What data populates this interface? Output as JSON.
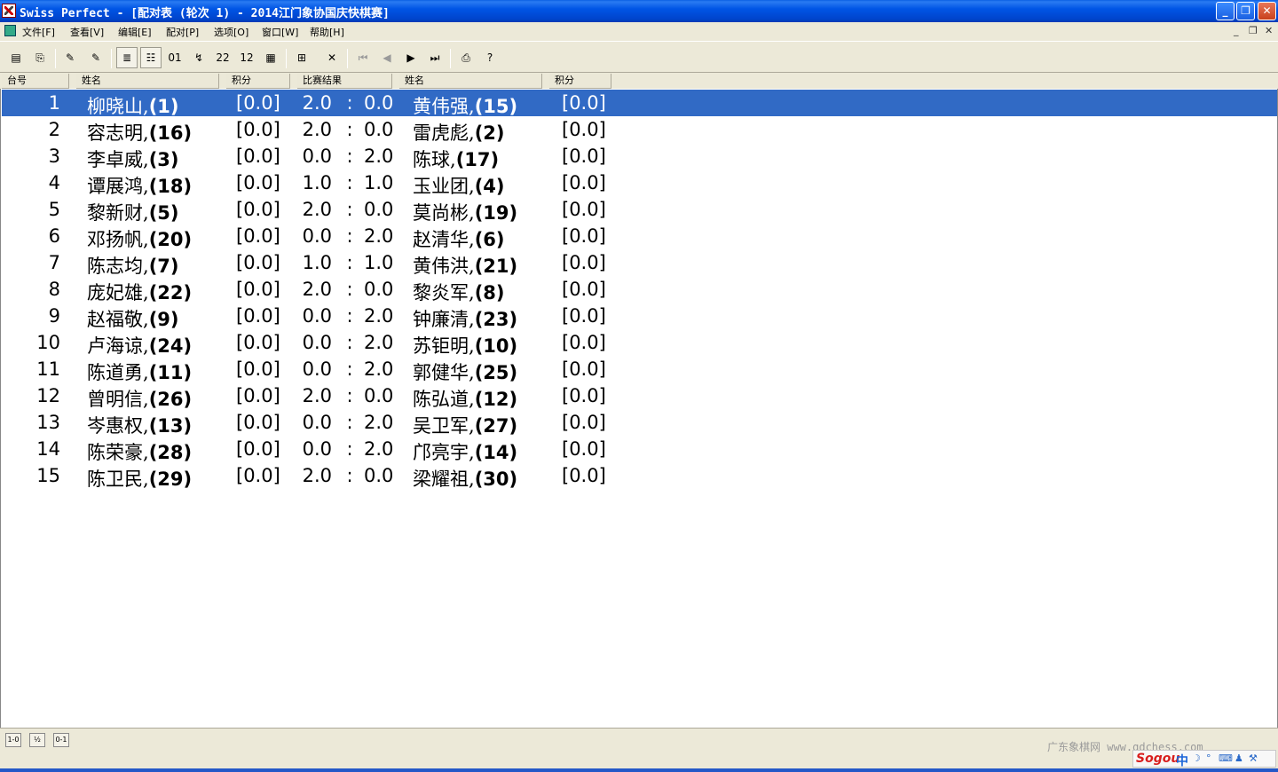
{
  "window": {
    "title": "Swiss Perfect - [配对表  (轮次 1) - 2014江门象协国庆快棋赛]",
    "minimize": "_",
    "maximize": "❐",
    "close": "✕"
  },
  "menu": {
    "items": [
      "文件[F]",
      "查看[V]",
      "编辑[E]",
      "配对[P]",
      "选项[O]",
      "窗口[W]",
      "帮助[H]"
    ],
    "mdi_min": "_",
    "mdi_restore": "❐",
    "mdi_close": "✕"
  },
  "toolbar": {
    "icons": {
      "new": "▤",
      "open": "⎘",
      "tool1": "✎",
      "tool2": "✎",
      "list1": "≣",
      "list2": "☷",
      "num1": "01",
      "num2": "↯",
      "num3": "22",
      "num4": "12",
      "img": "▦",
      "table": "⊞",
      "cross": "✕",
      "first": "⏮",
      "prev": "◀",
      "next": "▶",
      "last": "⏭",
      "print": "⎙",
      "help": "?"
    }
  },
  "columns": {
    "board": "台号",
    "name1": "姓名",
    "score1": "积分",
    "result": "比赛结果",
    "name2": "姓名",
    "score2": "积分"
  },
  "pairings": [
    {
      "board": "1",
      "p1": "柳晓山,",
      "s1seed": "(1)",
      "score1": "[0.0]",
      "r1": "2.0",
      "r2": "0.0",
      "p2": "黄伟强,",
      "s2seed": "(15)",
      "score2": "[0.0]"
    },
    {
      "board": "2",
      "p1": "容志明,",
      "s1seed": "(16)",
      "score1": "[0.0]",
      "r1": "2.0",
      "r2": "0.0",
      "p2": "雷虎彪,",
      "s2seed": "(2)",
      "score2": "[0.0]"
    },
    {
      "board": "3",
      "p1": "李卓威,",
      "s1seed": "(3)",
      "score1": "[0.0]",
      "r1": "0.0",
      "r2": "2.0",
      "p2": "陈球,",
      "s2seed": "(17)",
      "score2": "[0.0]"
    },
    {
      "board": "4",
      "p1": "谭展鸿,",
      "s1seed": "(18)",
      "score1": "[0.0]",
      "r1": "1.0",
      "r2": "1.0",
      "p2": "玉业团,",
      "s2seed": "(4)",
      "score2": "[0.0]"
    },
    {
      "board": "5",
      "p1": "黎新财,",
      "s1seed": "(5)",
      "score1": "[0.0]",
      "r1": "2.0",
      "r2": "0.0",
      "p2": "莫尚彬,",
      "s2seed": "(19)",
      "score2": "[0.0]"
    },
    {
      "board": "6",
      "p1": "邓扬帆,",
      "s1seed": "(20)",
      "score1": "[0.0]",
      "r1": "0.0",
      "r2": "2.0",
      "p2": "赵清华,",
      "s2seed": "(6)",
      "score2": "[0.0]"
    },
    {
      "board": "7",
      "p1": "陈志均,",
      "s1seed": "(7)",
      "score1": "[0.0]",
      "r1": "1.0",
      "r2": "1.0",
      "p2": "黄伟洪,",
      "s2seed": "(21)",
      "score2": "[0.0]"
    },
    {
      "board": "8",
      "p1": "庞妃雄,",
      "s1seed": "(22)",
      "score1": "[0.0]",
      "r1": "2.0",
      "r2": "0.0",
      "p2": "黎炎军,",
      "s2seed": "(8)",
      "score2": "[0.0]"
    },
    {
      "board": "9",
      "p1": "赵福敬,",
      "s1seed": "(9)",
      "score1": "[0.0]",
      "r1": "0.0",
      "r2": "2.0",
      "p2": "钟廉清,",
      "s2seed": "(23)",
      "score2": "[0.0]"
    },
    {
      "board": "10",
      "p1": "卢海谅,",
      "s1seed": "(24)",
      "score1": "[0.0]",
      "r1": "0.0",
      "r2": "2.0",
      "p2": "苏钜明,",
      "s2seed": "(10)",
      "score2": "[0.0]"
    },
    {
      "board": "11",
      "p1": "陈道勇,",
      "s1seed": "(11)",
      "score1": "[0.0]",
      "r1": "0.0",
      "r2": "2.0",
      "p2": "郭健华,",
      "s2seed": "(25)",
      "score2": "[0.0]"
    },
    {
      "board": "12",
      "p1": "曾明信,",
      "s1seed": "(26)",
      "score1": "[0.0]",
      "r1": "2.0",
      "r2": "0.0",
      "p2": "陈弘道,",
      "s2seed": "(12)",
      "score2": "[0.0]"
    },
    {
      "board": "13",
      "p1": "岑惠权,",
      "s1seed": "(13)",
      "score1": "[0.0]",
      "r1": "0.0",
      "r2": "2.0",
      "p2": "吴卫军,",
      "s2seed": "(27)",
      "score2": "[0.0]"
    },
    {
      "board": "14",
      "p1": "陈荣豪,",
      "s1seed": "(28)",
      "score1": "[0.0]",
      "r1": "0.0",
      "r2": "2.0",
      "p2": "邝亮宇,",
      "s2seed": "(14)",
      "score2": "[0.0]"
    },
    {
      "board": "15",
      "p1": "陈卫民,",
      "s1seed": "(29)",
      "score1": "[0.0]",
      "r1": "2.0",
      "r2": "0.0",
      "p2": "梁耀祖,",
      "s2seed": "(30)",
      "score2": "[0.0]"
    }
  ],
  "result_separator": ":",
  "selected_board": "1",
  "bottom": {
    "buttons": [
      "1-0",
      "½",
      "0-1"
    ],
    "watermark": "广东象棋网 www.gdchess.com",
    "ime_logo": "Sogou",
    "ime_mode": "中"
  },
  "colors": {
    "selection": "#316ac5",
    "titlebar": "#0055e5"
  }
}
